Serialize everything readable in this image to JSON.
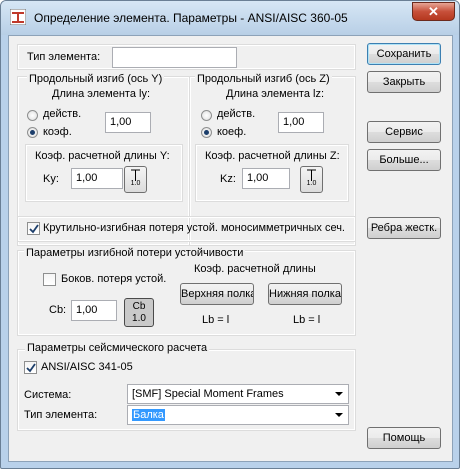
{
  "window": {
    "title": "Определение элемента. Параметры - ANSI/AISC 360-05",
    "close_symbol": "✕"
  },
  "member_type": {
    "label": "Тип элемента:",
    "value": ""
  },
  "buckling_y": {
    "title": "Продольный изгиб (ось Y)",
    "length_label": "Длина элемента ly:",
    "actual_label": "действ.",
    "coef_label": "коэф.",
    "selected": "coef",
    "length_value": "1,00",
    "k_title": "Коэф. расчетной длины Y:",
    "k_label": "Ky:",
    "k_value": "1,00",
    "k_icon_text": "1.0"
  },
  "buckling_z": {
    "title": "Продольный изгиб (ось Z)",
    "length_label": "Длина элемента lz:",
    "actual_label": "действ.",
    "coef_label": "коеф.",
    "selected": "coef",
    "length_value": "1,00",
    "k_title": "Коэф. расчетной длины Z:",
    "k_label": "Kz:",
    "k_value": "1,00",
    "k_icon_text": "1.0"
  },
  "torsional": {
    "label": "Крутильно-изгибная потеря устой. моносимметричных сеч.",
    "checked": true
  },
  "ltb": {
    "title": "Параметры изгибной потери устойчивости",
    "lateral_label": "Боков. потеря устой.",
    "lateral_checked": false,
    "cb_label": "Cb:",
    "cb_value": "1,00",
    "cb_icon_top": "Cb",
    "cb_icon_bottom": "1.0",
    "k_title": "Коэф. расчетной длины",
    "upper_button": "Верхняя полка",
    "lower_button": "Нижняя полка",
    "lb_upper": "Lb = l",
    "lb_lower": "Lb = l"
  },
  "seismic": {
    "title": "Параметры сейсмического расчета",
    "code_label": "ANSI/AISC 341-05",
    "code_checked": true,
    "system_label": "Система:",
    "system_value": "[SMF] Special Moment Frames",
    "element_label": "Тип элемента:",
    "element_value": "Балка"
  },
  "buttons": {
    "save": "Сохранить",
    "close": "Закрыть",
    "service": "Сервис",
    "more": "Больше...",
    "stiffeners": "Ребра жестк.",
    "help": "Помощь"
  },
  "colors": {
    "title_gradient_top": "#d6e6f5",
    "close_red": "#c7503a",
    "selection": "#3399ff"
  }
}
